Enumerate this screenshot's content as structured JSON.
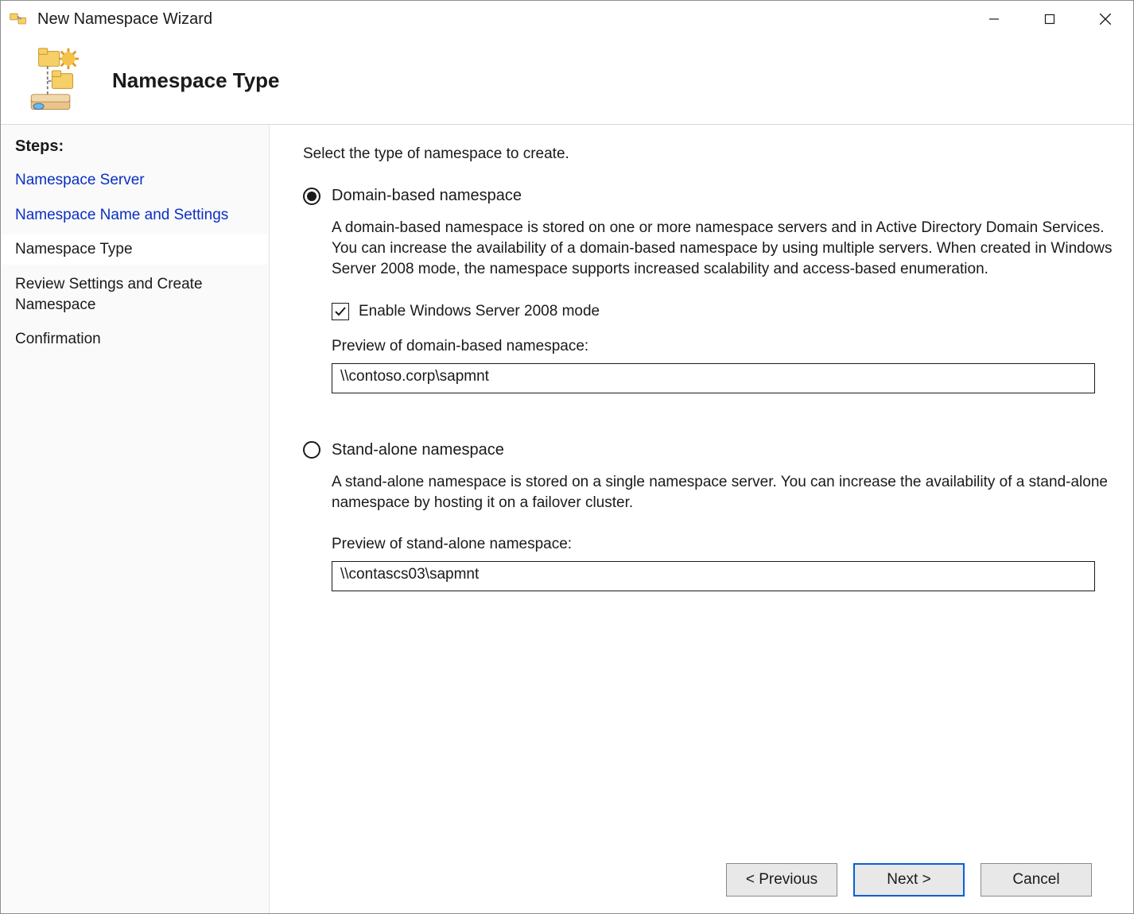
{
  "window": {
    "title": "New Namespace Wizard"
  },
  "banner": {
    "title": "Namespace Type"
  },
  "sidebar": {
    "steps_label": "Steps:",
    "items": [
      {
        "label": "Namespace Server",
        "state": "done"
      },
      {
        "label": "Namespace Name and Settings",
        "state": "done"
      },
      {
        "label": "Namespace Type",
        "state": "current"
      },
      {
        "label": "Review Settings and Create Namespace",
        "state": "pending"
      },
      {
        "label": "Confirmation",
        "state": "pending"
      }
    ]
  },
  "main": {
    "instruction": "Select the type of namespace to create.",
    "domain": {
      "label": "Domain-based namespace",
      "selected": true,
      "description": "A domain-based namespace is stored on one or more namespace servers and in Active Directory Domain Services. You can increase the availability of a domain-based namespace by using multiple servers. When created in Windows Server 2008 mode, the namespace supports increased scalability and access-based enumeration.",
      "checkbox_label": "Enable Windows Server 2008 mode",
      "checkbox_checked": true,
      "preview_label": "Preview of domain-based namespace:",
      "preview_value": "\\\\contoso.corp\\sapmnt"
    },
    "standalone": {
      "label": "Stand-alone namespace",
      "selected": false,
      "description": "A stand-alone namespace is stored on a single namespace server. You can increase the availability of a stand-alone namespace by hosting it on a failover cluster.",
      "preview_label": "Preview of stand-alone namespace:",
      "preview_value": "\\\\contascs03\\sapmnt"
    }
  },
  "footer": {
    "previous": "< Previous",
    "next": "Next >",
    "cancel": "Cancel"
  }
}
